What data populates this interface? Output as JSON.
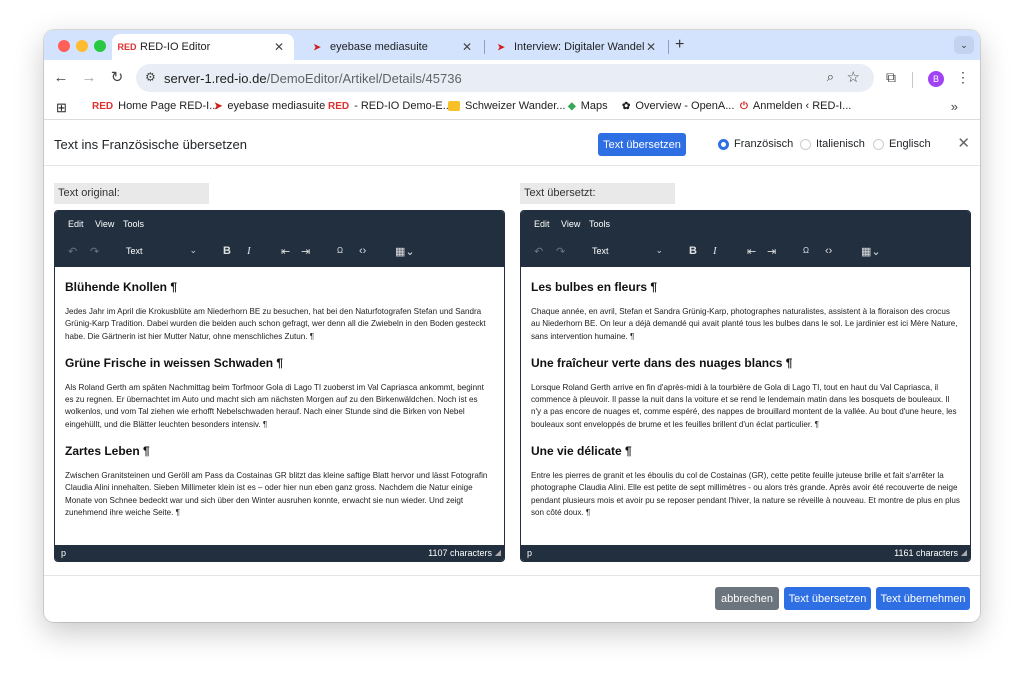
{
  "browser": {
    "tabs": [
      {
        "favicon": "red-io-logo",
        "title": "RED-IO Editor",
        "active": true
      },
      {
        "favicon": "eyebase-logo",
        "title": "eyebase mediasuite",
        "active": false
      },
      {
        "favicon": "eyebase-logo",
        "title": "Interview: Digitaler Wandel im",
        "active": false
      }
    ],
    "url_host": "server-1.red-io.de",
    "url_path": "/DemoEditor/Artikel/Details/45736",
    "profile_initial": "B",
    "bookmarks": [
      {
        "icon": "red-io-logo",
        "label": "Home Page RED-I..."
      },
      {
        "icon": "eyebase-logo",
        "label": "eyebase mediasuite"
      },
      {
        "icon": "red-io-logo",
        "label": "- RED-IO Demo-E..."
      },
      {
        "icon": "folder-icon",
        "label": "Schweizer Wander..."
      },
      {
        "icon": "maps-icon",
        "label": "Maps"
      },
      {
        "icon": "openai-icon",
        "label": "Overview - OpenA..."
      },
      {
        "icon": "power-icon",
        "label": "Anmelden ‹ RED-I..."
      }
    ],
    "bookmarks_more": "»"
  },
  "modal": {
    "title": "Text ins Französische übersetzen",
    "translate_button": "Text übersetzen",
    "languages": [
      {
        "label": "Französisch",
        "checked": true
      },
      {
        "label": "Italienisch",
        "checked": false
      },
      {
        "label": "Englisch",
        "checked": false
      }
    ],
    "close_glyph": "✕"
  },
  "editor_menu": {
    "edit": "Edit",
    "view": "View",
    "tools": "Tools",
    "format_select": "Text"
  },
  "original": {
    "label": "Text original:",
    "h1": "Blühende Knollen ¶",
    "p1": "Jedes Jahr im April die Krokusblüte am Niederhorn BE zu besuchen, hat bei den Naturfotografen Stefan und Sandra Grünig-Karp Tradition. Dabei wurden die beiden auch schon gefragt, wer denn all die Zwiebeln in den Boden gesteckt habe. Die Gärtnerin ist hier Mutter Natur, ohne menschliches Zutun. ¶",
    "h2": "Grüne Frische in weissen Schwaden ¶",
    "p2": "Als Roland Gerth am späten Nachmittag beim Torfmoor Gola di Lago TI zuoberst im Val Capriasca ankommt, beginnt es zu regnen. Er übernachtet im Auto und macht sich am nächsten Morgen auf zu den Birkenwäldchen. Noch ist es wolkenlos, und vom Tal ziehen wie erhofft Nebelschwaden herauf. Nach einer Stunde sind die Birken von Nebel eingehüllt, und die Blätter leuchten besonders intensiv. ¶",
    "h3": "Zartes Leben ¶",
    "p3": "Zwischen Granitsteinen und Geröll am Pass da Costainas GR blitzt das kleine saftige Blatt hervor und lässt Fotografin Claudia Alini innehalten. Sieben Millimeter klein ist es – oder hier nun eben ganz gross. Nachdem die Natur einige Monate von Schnee bedeckt war und sich über den Winter ausruhen konnte, erwacht sie nun wieder. Und zeigt zunehmend ihre weiche Seite. ¶",
    "status_path": "p",
    "char_count": "1107 characters"
  },
  "translated": {
    "label": "Text übersetzt:",
    "h1": "Les bulbes en fleurs ¶",
    "p1": "Chaque année, en avril, Stefan et Sandra Grünig-Karp, photographes naturalistes, assistent à la floraison des crocus au Niederhorn BE. On leur a déjà demandé qui avait planté tous les bulbes dans le sol. Le jardinier est ici Mère Nature, sans intervention humaine. ¶",
    "h2": "Une fraîcheur verte dans des nuages blancs ¶",
    "p2": "Lorsque Roland Gerth arrive en fin d'après-midi à la tourbière de Gola di Lago TI, tout en haut du Val Capriasca, il commence à pleuvoir. Il passe la nuit dans la voiture et se rend le lendemain matin dans les bosquets de bouleaux. Il n'y a pas encore de nuages et, comme espéré, des nappes de brouillard montent de la vallée. Au bout d'une heure, les bouleaux sont enveloppés de brume et les feuilles brillent d'un éclat particulier. ¶",
    "h3": "Une vie délicate ¶",
    "p3": "Entre les pierres de granit et les éboulis du col de Costainas (GR), cette petite feuille juteuse brille et fait s'arrêter la photographe Claudia Alini. Elle est petite de sept millimètres - ou alors très grande. Après avoir été recouverte de neige pendant plusieurs mois et avoir pu se reposer pendant l'hiver, la nature se réveille à nouveau. Et montre de plus en plus son côté doux. ¶",
    "status_path": "p",
    "char_count": "1161 characters"
  },
  "footer": {
    "cancel": "abbrechen",
    "translate": "Text übersetzen",
    "apply": "Text übernehmen"
  },
  "colors": {
    "primary": "#2f6fe4",
    "editor_chrome": "#222f3e",
    "secondary": "#6c757d"
  }
}
